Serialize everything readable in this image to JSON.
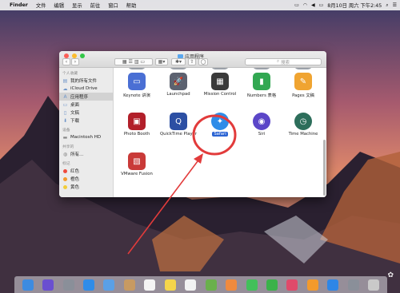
{
  "menubar": {
    "app_name": "Finder",
    "items": [
      "文件",
      "编辑",
      "显示",
      "前往",
      "窗口",
      "帮助"
    ],
    "datetime": "8月10日 周六 下午2:45"
  },
  "window": {
    "title": "应用程序",
    "search_placeholder": "搜索",
    "sidebar": {
      "favorites_header": "个人收藏",
      "favorites": [
        {
          "icon": "recent-icon",
          "label": "我的所有文件"
        },
        {
          "icon": "cloud-icon",
          "label": "iCloud Drive"
        },
        {
          "icon": "apps-icon",
          "label": "应用程序"
        },
        {
          "icon": "desktop-icon",
          "label": "桌面"
        },
        {
          "icon": "documents-icon",
          "label": "文稿"
        },
        {
          "icon": "download-icon",
          "label": "下载"
        }
      ],
      "devices_header": "设备",
      "devices": [
        {
          "icon": "disk-icon",
          "label": "Macintosh HD"
        }
      ],
      "shared_header": "共享的",
      "shared": [
        {
          "icon": "network-icon",
          "label": "所有..."
        }
      ],
      "tags_header": "标记",
      "tags": [
        {
          "label": "红色",
          "color": "#ee4b3e"
        },
        {
          "label": "橙色",
          "color": "#f39a2c"
        },
        {
          "label": "黄色",
          "color": "#f2cd3a"
        }
      ]
    },
    "apps": [
      {
        "label": "Keynote 讲演",
        "icon": "keynote-icon",
        "color": "#4a6fd4",
        "glyph": "▭"
      },
      {
        "label": "Launchpad",
        "icon": "launchpad-icon",
        "color": "#5c6270",
        "glyph": "🚀"
      },
      {
        "label": "Mission Control",
        "icon": "mission-control-icon",
        "color": "#3a3a3a",
        "glyph": "▦"
      },
      {
        "label": "Numbers 表格",
        "icon": "numbers-icon",
        "color": "#32a852",
        "glyph": "▮"
      },
      {
        "label": "Pages 文稿",
        "icon": "pages-icon",
        "color": "#f0a431",
        "glyph": "✎"
      },
      {
        "label": "Photo Booth",
        "icon": "photo-booth-icon",
        "color": "#b21f2a",
        "glyph": "▣"
      },
      {
        "label": "QuickTime Player",
        "icon": "quicktime-icon",
        "color": "#2c4fa3",
        "glyph": "Q"
      },
      {
        "label": "Safari",
        "icon": "safari-icon",
        "color": "#2f8ce8",
        "glyph": "✦"
      },
      {
        "label": "Siri",
        "icon": "siri-icon",
        "color": "#5b46c8",
        "glyph": "◉"
      },
      {
        "label": "Time Machine",
        "icon": "time-machine-icon",
        "color": "#2d6e5b",
        "glyph": "◷"
      },
      {
        "label": "VMware Fusion",
        "icon": "vmware-icon",
        "color": "#c93a38",
        "glyph": "▧"
      }
    ],
    "selected_app": "Safari"
  },
  "annotation": {
    "color": "#e23b3b"
  },
  "dock_icons": [
    {
      "icon": "finder-icon",
      "color": "#3d8be0"
    },
    {
      "icon": "siri-icon",
      "color": "#6a4fd0"
    },
    {
      "icon": "launchpad-icon",
      "color": "#8a8f99"
    },
    {
      "icon": "safari-icon",
      "color": "#2f8ce8"
    },
    {
      "icon": "mail-icon",
      "color": "#5aa0e6"
    },
    {
      "icon": "contacts-icon",
      "color": "#c79a62"
    },
    {
      "icon": "calendar-icon",
      "color": "#f4f4f4"
    },
    {
      "icon": "notes-icon",
      "color": "#f5d54a"
    },
    {
      "icon": "reminders-icon",
      "color": "#f2f2f2"
    },
    {
      "icon": "maps-icon",
      "color": "#6ab04c"
    },
    {
      "icon": "photos-icon",
      "color": "#f08a3e"
    },
    {
      "icon": "messages-icon",
      "color": "#42c05a"
    },
    {
      "icon": "facetime-icon",
      "color": "#3bb24a"
    },
    {
      "icon": "music-icon",
      "color": "#e04a6a"
    },
    {
      "icon": "ibooks-icon",
      "color": "#f39a2c"
    },
    {
      "icon": "app-store-icon",
      "color": "#2e86e6"
    },
    {
      "icon": "preferences-icon",
      "color": "#8a8f99"
    },
    {
      "icon": "trash-icon",
      "color": "#c9c9c9"
    }
  ]
}
